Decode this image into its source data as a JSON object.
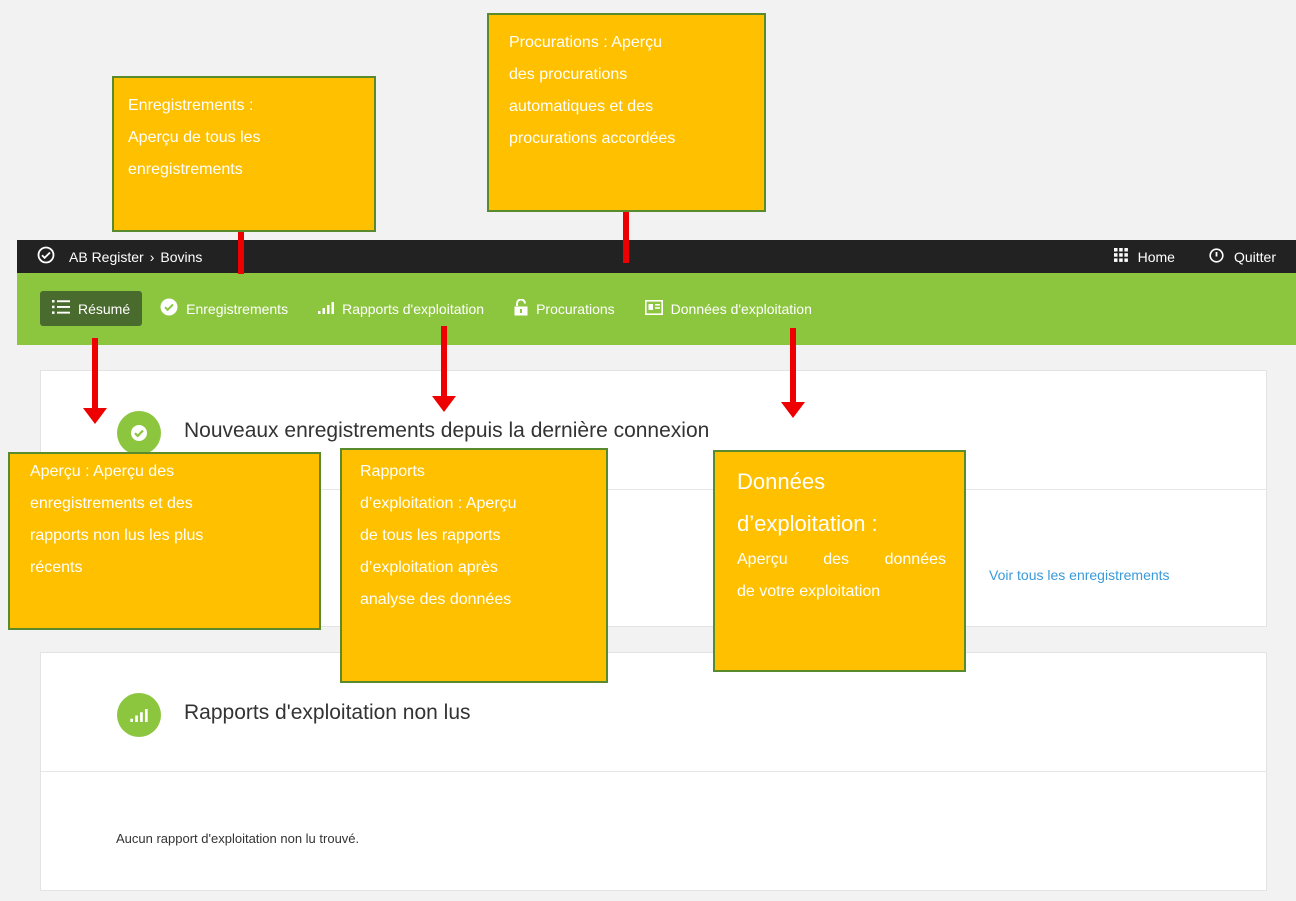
{
  "topbar": {
    "app_name": "AB Register",
    "breadcrumb_sep": "›",
    "section": "Bovins",
    "home_label": "Home",
    "quit_label": "Quitter"
  },
  "nav": {
    "items": [
      {
        "label": "Résumé",
        "icon": "list-icon",
        "active": true
      },
      {
        "label": "Enregistrements",
        "icon": "check-circle-icon"
      },
      {
        "label": "Rapports d'exploitation",
        "icon": "signal-bars-icon"
      },
      {
        "label": "Procurations",
        "icon": "lock-icon"
      },
      {
        "label": "Données d'exploitation",
        "icon": "id-card-icon"
      }
    ]
  },
  "panels": {
    "new_records": {
      "title": "Nouveaux enregistrements depuis la dernière connexion",
      "link": "Voir tous les enregistrements"
    },
    "unread_reports": {
      "title": "Rapports d'exploitation non lus",
      "empty": "Aucun rapport d'exploitation non lu trouvé."
    }
  },
  "callouts": {
    "enregistrements": [
      "Enregistrements :",
      "Aperçu de tous les",
      "enregistrements"
    ],
    "procurations": [
      "Procurations : Aperçu",
      "des procurations",
      "automatiques et des",
      "procurations accordées"
    ],
    "apercu": [
      "Aperçu : Aperçu des",
      "enregistrements et des",
      "rapports non lus les plus",
      "récents"
    ],
    "rapports": [
      "Rapports",
      "d’exploitation : Aperçu",
      "de tous les rapports",
      "d’exploitation après",
      "analyse des données"
    ],
    "donnees_title": "Données",
    "donnees": [
      "d’exploitation :",
      "Aperçu des données",
      "de votre exploitation"
    ]
  },
  "colors": {
    "nav_green": "#8cc63f",
    "nav_active": "#4a6b2e",
    "topbar": "#222222",
    "callout_fill": "#ffc000",
    "callout_border": "#5a8a2e",
    "arrow": "#e00000",
    "link": "#3a9ad9"
  }
}
